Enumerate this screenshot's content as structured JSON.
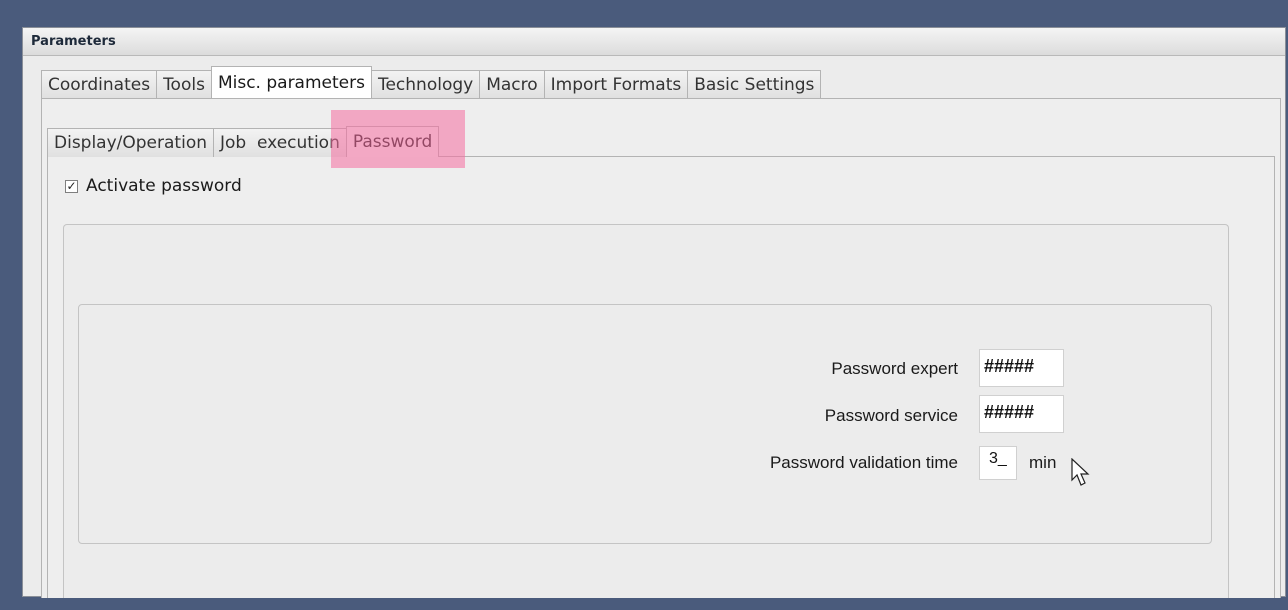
{
  "window": {
    "title": "Parameters"
  },
  "main_tabs": [
    {
      "label": "Coordinates",
      "active": false
    },
    {
      "label": "Tools",
      "active": false
    },
    {
      "label": "Misc. parameters",
      "active": true
    },
    {
      "label": "Technology",
      "active": false
    },
    {
      "label": "Macro",
      "active": false
    },
    {
      "label": "Import Formats",
      "active": false
    },
    {
      "label": "Basic Settings",
      "active": false
    }
  ],
  "sub_tabs": [
    {
      "label": "Display/Operation",
      "active": false
    },
    {
      "label": "Job  execution",
      "active": false
    },
    {
      "label": "Password",
      "active": true
    }
  ],
  "activate_password": {
    "label": "Activate password",
    "checked": true
  },
  "fields": {
    "expert": {
      "label": "Password expert",
      "value": "#####"
    },
    "service": {
      "label": "Password service",
      "value": "#####"
    },
    "validation": {
      "label": "Password validation time",
      "value": "3_",
      "unit": "min"
    }
  },
  "colors": {
    "highlight": "#f56ea0",
    "background": "#4a5b7c"
  },
  "icons": {
    "checkbox": "check-icon",
    "cursor": "mouse-pointer-icon"
  }
}
